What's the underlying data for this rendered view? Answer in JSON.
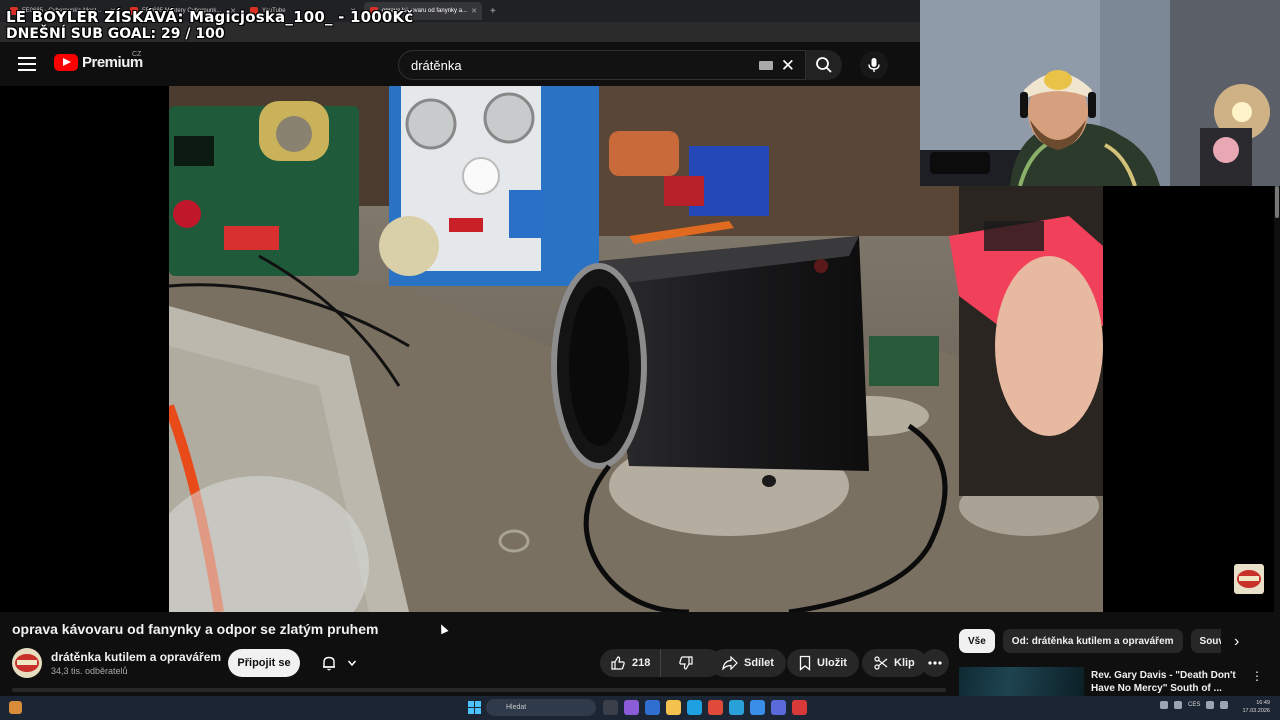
{
  "browser": {
    "tabs": [
      {
        "label": "FE0685 - Cyberpunk's Most...",
        "active": false
      },
      {
        "label": "FE0685 Mystery Cyberpunk...",
        "active": false
      },
      {
        "label": "YouTube",
        "active": false
      },
      {
        "label": "oprava kávovaru od fanynky a...",
        "active": true
      }
    ],
    "new_tab_glyph": "+"
  },
  "stream_overlay": {
    "line1": "LE BOYLER ZÍSKÁVÁ: Magicjoska_100_ - 1000Kč",
    "line2": "DNEŠNÍ SUB GOAL: 29 / 100"
  },
  "header": {
    "logo_word": "Premium",
    "logo_region": "CZ",
    "search_value": "drátěnka"
  },
  "video": {
    "title": "oprava kávovaru od fanynky a odpor se zlatým pruhem"
  },
  "channel": {
    "name": "drátěnka kutilem a opravářem",
    "subscribers": "34,3 tis. odběratelů",
    "join_label": "Připojit se"
  },
  "actions": {
    "like_count": "218",
    "share_label": "Sdílet",
    "save_label": "Uložit",
    "clip_label": "Klip"
  },
  "sidebar": {
    "chips": [
      {
        "label": "Vše",
        "active": true
      },
      {
        "label": "Od: drátěnka kutilem a opravářem",
        "active": false
      },
      {
        "label": "Souvi",
        "active": false
      }
    ],
    "recommendation": {
      "title": "Rev. Gary Davis - \"Death Don't Have No Mercy\" South of ..."
    }
  },
  "taskbar": {
    "search_placeholder": "Hledat",
    "tray_lang": "CES",
    "clock_time": "16:49",
    "clock_date": "17.03.2026"
  },
  "colors": {
    "background": "#0f0f0f",
    "brand_red": "#ff0000",
    "pill_bg": "#272727",
    "text_primary": "#f1f1f1",
    "text_secondary": "#aaaaaa"
  }
}
